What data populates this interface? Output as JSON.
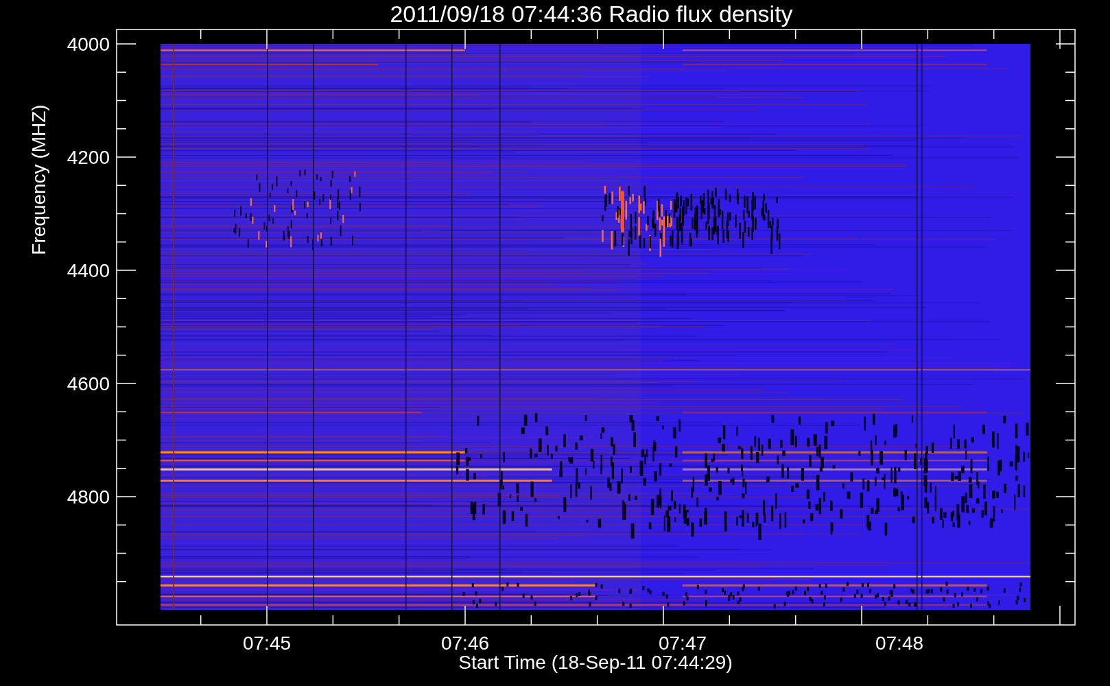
{
  "title": "2011/09/18 07:44:36 Radio flux density",
  "y_axis": {
    "label": "Frequency (MHZ)",
    "ticks": [
      "4000",
      "4200",
      "4400",
      "4600",
      "4800"
    ]
  },
  "x_axis": {
    "label": "Start Time (18-Sep-11 07:44:29)",
    "ticks": [
      "07:45",
      "07:46",
      "07:47",
      "07:48"
    ]
  }
}
